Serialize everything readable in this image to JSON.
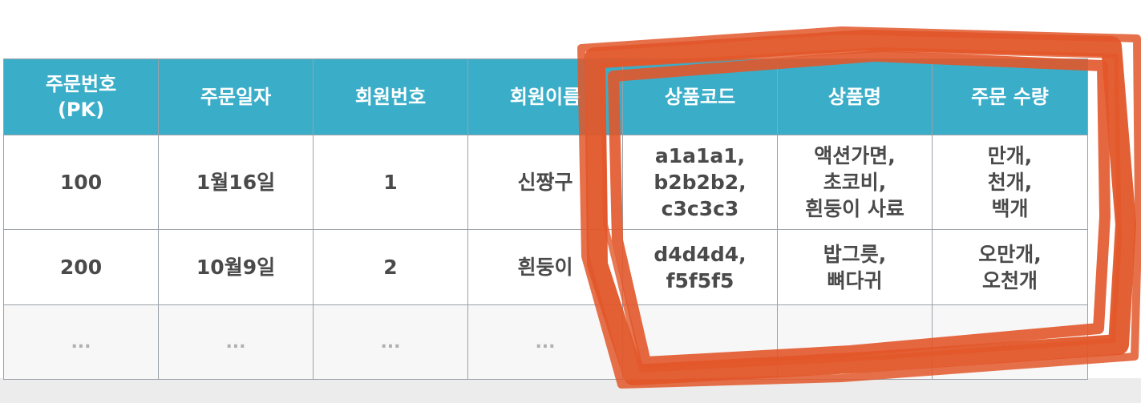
{
  "table": {
    "headers": [
      [
        "주문번호",
        "(PK)"
      ],
      [
        "주문일자"
      ],
      [
        "회원번호"
      ],
      [
        "회원이름"
      ],
      [
        "상품코드"
      ],
      [
        "상품명"
      ],
      [
        "주문 수량"
      ]
    ],
    "rows": [
      [
        [
          "100"
        ],
        [
          "1월16일"
        ],
        [
          "1"
        ],
        [
          "신짱구"
        ],
        [
          "a1a1a1,",
          "b2b2b2,",
          "c3c3c3"
        ],
        [
          "액션가면,",
          "초코비,",
          "흰둥이 사료"
        ],
        [
          "만개,",
          "천개,",
          "백개"
        ]
      ],
      [
        [
          "200"
        ],
        [
          "10월9일"
        ],
        [
          "2"
        ],
        [
          "흰둥이"
        ],
        [
          "d4d4d4,",
          "f5f5f5"
        ],
        [
          "밥그릇,",
          "뼈다귀"
        ],
        [
          "오만개,",
          "오천개"
        ]
      ],
      [
        [
          "..."
        ],
        [
          "..."
        ],
        [
          "..."
        ],
        [
          "..."
        ],
        [
          ""
        ],
        [
          ""
        ],
        [
          "..."
        ]
      ]
    ]
  },
  "highlight": {
    "color": "#e2572a",
    "target_columns": [
      "상품코드",
      "상품명",
      "주문 수량"
    ]
  }
}
